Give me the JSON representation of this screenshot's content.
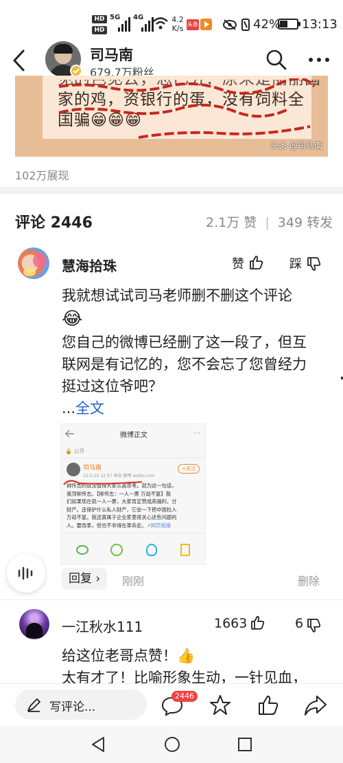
{
  "status": {
    "hd1": "HD 1",
    "hd2": "HD 2",
    "net1": "5G",
    "net2": "4G",
    "speed_value": "4.2",
    "speed_unit": "K/s",
    "app_badge": "头条",
    "battery": "42%",
    "time": "13:13"
  },
  "header": {
    "author": "司马南",
    "followers": "679.7万粉丝"
  },
  "post": {
    "image_text_line1": "家的鸡，资银行的蛋，没有饲料全",
    "image_text_line2": "国骗😁😁😁",
    "watermark": "头条 @司马南",
    "views": "102万展现"
  },
  "comments_header": {
    "title": "评论 2446",
    "likes": "2.1万 赞",
    "separator": "|",
    "reposts": "349 转发"
  },
  "comments": [
    {
      "user": "慧海拾珠",
      "like_label": "赞",
      "dislike_label": "踩",
      "text_line1": "我就想试试司马老师删不删这个评论",
      "emoji": "😂",
      "text_line2": "您自己的微博已经删了这一段了，但互",
      "text_line3": "联网是有记忆的，您不会忘了您曾经力",
      "text_line4": "挺过这位爷吧？",
      "more_prefix": "...",
      "more_link": "全文",
      "reply_label": "回复",
      "reply_chevron": "›",
      "time": "刚刚",
      "delete_label": "删除"
    },
    {
      "user": "一江秋水111",
      "like_count": "1663",
      "dislike_count": "6",
      "text_line1": "给这位老哥点赞！👍",
      "text_line2": "太有才了！比喻形象生动，一针见血，"
    }
  ],
  "embedded_screenshot": {
    "title": "微博正文",
    "visibility": "公开",
    "author": "司马南",
    "meta": "12-2-20 12:57  来自 微博 weibo.com",
    "follow": "+关注",
    "text_line1": "柳传志的说法值得大家认真思考。就为这一句话，",
    "text_line2": "我顶柳传志。【柳传志：一人一票 万劫不复】我",
    "text_line3": "们如果现在就一人一票，大家肯定赞成高福利，分",
    "text_line4": "财产。还保护什么私人财产，它会一下把中国拉入",
    "text_line5": "万劫不复。我还真属于企业家里很关心这些问题的",
    "text_line6": "人。要改革，但也不非得在革命走。",
    "link": "↗网页链接"
  },
  "bottom_bar": {
    "write_placeholder": "写评论...",
    "comment_count_badge": "2446"
  },
  "colors": {
    "link_blue": "#1a62c9",
    "badge_red": "#f04142",
    "grey_text": "#888888",
    "divider": "#f2f2f2"
  }
}
